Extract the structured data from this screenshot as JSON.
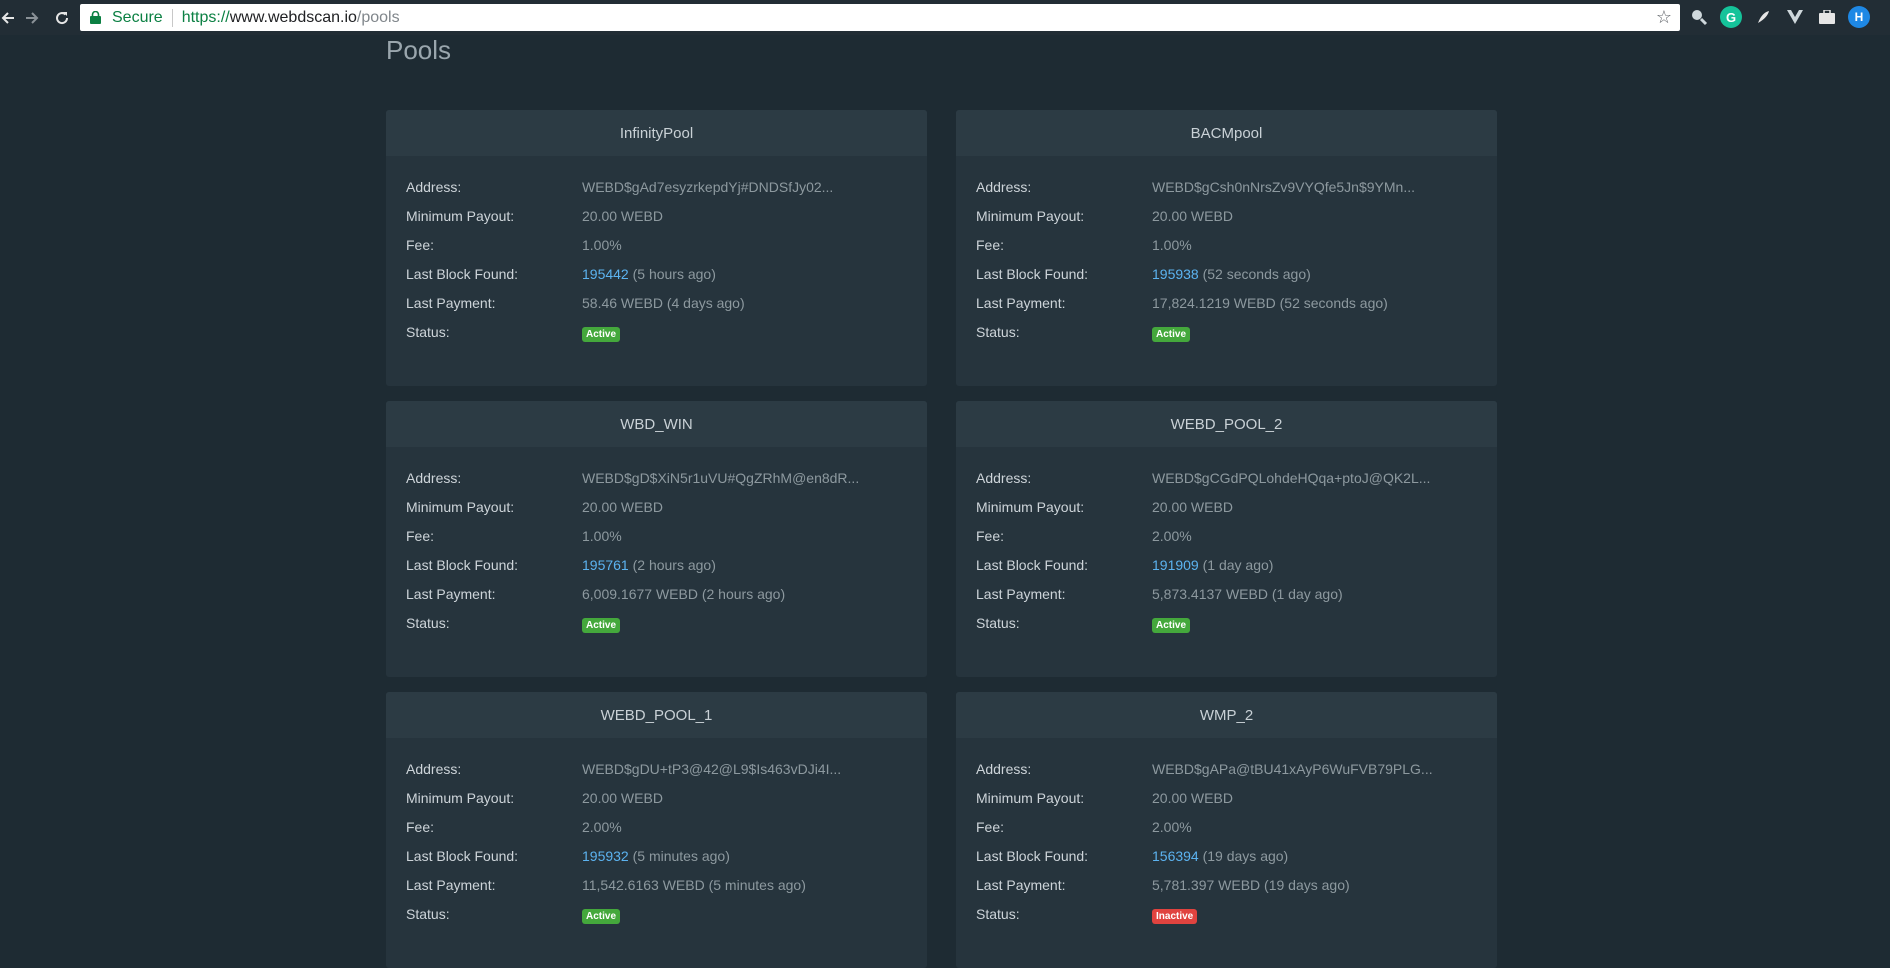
{
  "browser": {
    "secure_label": "Secure",
    "url_scheme": "https://",
    "url_host": "www.webdscan.io",
    "url_path": "/pools",
    "extensions": [
      "magnifier-icon",
      "grammarly-icon",
      "feather-icon",
      "vue-icon",
      "briefcase-icon",
      "profile-icon"
    ],
    "profile_initial": "H"
  },
  "page": {
    "title": "Pools"
  },
  "labels": {
    "address": "Address:",
    "min_payout": "Minimum Payout:",
    "fee": "Fee:",
    "last_block": "Last Block Found:",
    "last_payment": "Last Payment:",
    "status": "Status:"
  },
  "pools": [
    {
      "name": "InfinityPool",
      "address": "WEBD$gAd7esyzrkepdYj#DNDSfJy02...",
      "min_payout": "20.00 WEBD",
      "fee": "1.00%",
      "last_block": "195442",
      "last_block_ago": "(5 hours ago)",
      "last_payment": "58.46 WEBD (4 days ago)",
      "status": "Active",
      "status_color": "#44a83c"
    },
    {
      "name": "BACMpool",
      "address": "WEBD$gCsh0nNrsZv9VYQfe5Jn$9YMn...",
      "min_payout": "20.00 WEBD",
      "fee": "1.00%",
      "last_block": "195938",
      "last_block_ago": "(52 seconds ago)",
      "last_payment": "17,824.1219 WEBD (52 seconds ago)",
      "status": "Active",
      "status_color": "#44a83c"
    },
    {
      "name": "WBD_WIN",
      "address": "WEBD$gD$XiN5r1uVU#QgZRhM@en8dR...",
      "min_payout": "20.00 WEBD",
      "fee": "1.00%",
      "last_block": "195761",
      "last_block_ago": "(2 hours ago)",
      "last_payment": "6,009.1677 WEBD (2 hours ago)",
      "status": "Active",
      "status_color": "#44a83c"
    },
    {
      "name": "WEBD_POOL_2",
      "address": "WEBD$gCGdPQLohdeHQqa+ptoJ@QK2L...",
      "min_payout": "20.00 WEBD",
      "fee": "2.00%",
      "last_block": "191909",
      "last_block_ago": "(1 day ago)",
      "last_payment": "5,873.4137 WEBD (1 day ago)",
      "status": "Active",
      "status_color": "#44a83c"
    },
    {
      "name": "WEBD_POOL_1",
      "address": "WEBD$gDU+tP3@42@L9$Is463vDJi4I...",
      "min_payout": "20.00 WEBD",
      "fee": "2.00%",
      "last_block": "195932",
      "last_block_ago": "(5 minutes ago)",
      "last_payment": "11,542.6163 WEBD (5 minutes ago)",
      "status": "Active",
      "status_color": "#44a83c"
    },
    {
      "name": "WMP_2",
      "address": "WEBD$gAPa@tBU41xAyP6WuFVB79PLG...",
      "min_payout": "20.00 WEBD",
      "fee": "2.00%",
      "last_block": "156394",
      "last_block_ago": "(19 days ago)",
      "last_payment": "5,781.397 WEBD (19 days ago)",
      "status": "Inactive",
      "status_color": "#e0433f"
    }
  ]
}
